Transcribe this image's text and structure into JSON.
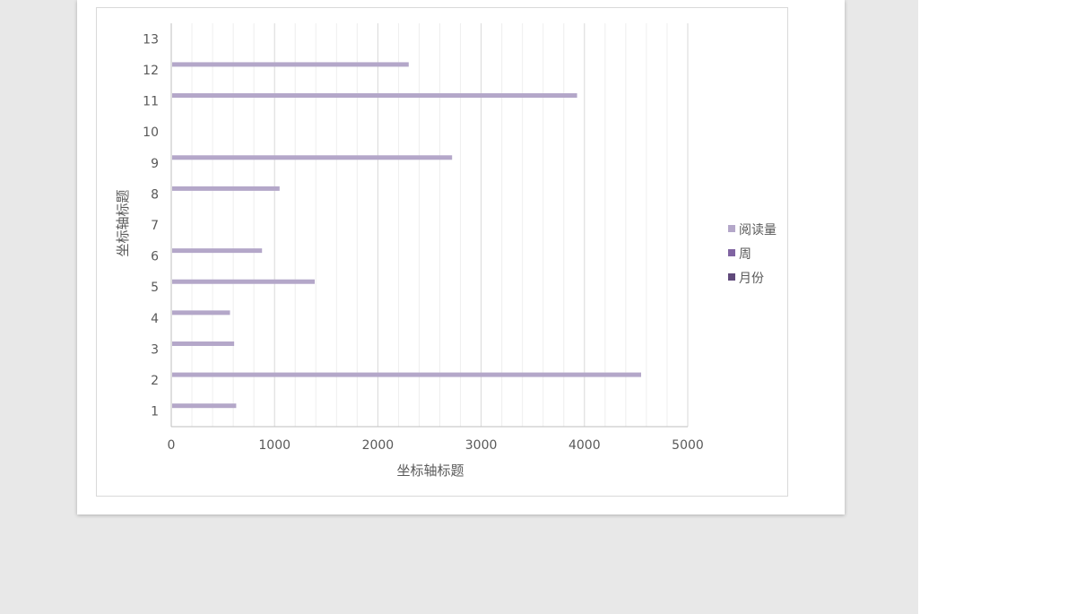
{
  "chart_data": {
    "type": "bar",
    "orientation": "horizontal",
    "categories": [
      "1",
      "2",
      "3",
      "4",
      "5",
      "6",
      "7",
      "8",
      "9",
      "10",
      "11",
      "12",
      "13"
    ],
    "series": [
      {
        "name": "阅读量",
        "color": "#b4a7c9",
        "values": [
          620,
          4540,
          600,
          560,
          1380,
          870,
          null,
          1040,
          2710,
          null,
          3920,
          2290,
          null
        ]
      },
      {
        "name": "周",
        "color": "#8064a2",
        "values": []
      },
      {
        "name": "月份",
        "color": "#604a7b",
        "values": []
      }
    ],
    "xlabel": "坐标轴标题",
    "ylabel": "坐标轴标题",
    "xlim": [
      0,
      5000
    ],
    "x_ticks": [
      "0",
      "1000",
      "2000",
      "3000",
      "4000",
      "5000"
    ],
    "grid": "vertical major and minor",
    "legend_position": "right"
  }
}
